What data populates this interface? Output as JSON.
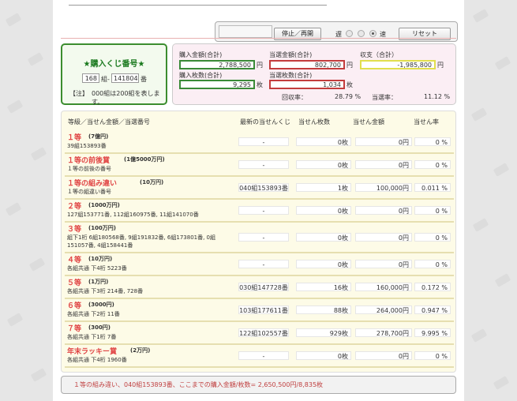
{
  "controls": {
    "stop_resume": "停止／再開",
    "slow_label": "遅",
    "fast_label": "速",
    "reset": "リセット",
    "speed_selected": "fast"
  },
  "ticket": {
    "title": "★購入くじ番号★",
    "group_value": "168",
    "group_suffix": "組-",
    "number_value": "141804",
    "number_suffix": "番",
    "note_label": "【注】",
    "note_text": "000組は200組を表します。"
  },
  "summary": {
    "purchase_amount_label": "購入金額(合計)",
    "purchase_amount": "2,788,500",
    "yen": "円",
    "purchase_count_label": "購入枚数(合計)",
    "purchase_count": "9,295",
    "mai": "枚",
    "win_amount_label": "当選金額(合計)",
    "win_amount": "802,700",
    "win_count_label": "当選枚数(合計)",
    "win_count": "1,034",
    "balance_label": "収支（合計）",
    "balance": "-1,985,800",
    "return_rate_label": "回収率：",
    "return_rate": "28.79 %",
    "win_rate_label": "当選率：",
    "win_rate": "11.12 %"
  },
  "table": {
    "headers": {
      "prize": "等級／当せん金額／当選番号",
      "latest": "最新の当せんくじ",
      "count": "当せん枚数",
      "amount": "当せん金額",
      "rate": "当せん率"
    },
    "rows": [
      {
        "name": "１等",
        "amount": "(7億円)",
        "sub1": "39組153893番",
        "sub2": "",
        "latest": "-",
        "count": "0枚",
        "money": "0円",
        "rate": "0 %"
      },
      {
        "name": "１等の前後賞",
        "amount": "(1億5000万円)",
        "sub1": "１等の前後の番号",
        "sub2": "",
        "latest": "-",
        "count": "0枚",
        "money": "0円",
        "rate": "0 %"
      },
      {
        "name": "１等の組み違い",
        "amount": "(10万円)",
        "sub1": "１等の組違い番号",
        "sub2": "",
        "latest": "040組153893番",
        "count": "1枚",
        "money": "100,000円",
        "rate": "0.011 %"
      },
      {
        "name": "２等",
        "amount": "(1000万円)",
        "sub1": "127組153771番, 112組160975番, 11組141070番",
        "sub2": "",
        "latest": "-",
        "count": "0枚",
        "money": "0円",
        "rate": "0 %"
      },
      {
        "name": "３等",
        "amount": "(100万円)",
        "sub1": "組下1桁 6組180568番, 9組191832番, 6組173801番, 0組",
        "sub2": "151057番, 4組158441番",
        "latest": "-",
        "count": "0枚",
        "money": "0円",
        "rate": "0 %"
      },
      {
        "name": "４等",
        "amount": "(10万円)",
        "sub1": "各組共通 下4桁 5223番",
        "sub2": "",
        "latest": "-",
        "count": "0枚",
        "money": "0円",
        "rate": "0 %"
      },
      {
        "name": "５等",
        "amount": "(1万円)",
        "sub1": "各組共通 下3桁 214番, 728番",
        "sub2": "",
        "latest": "030組147728番",
        "count": "16枚",
        "money": "160,000円",
        "rate": "0.172 %"
      },
      {
        "name": "６等",
        "amount": "(3000円)",
        "sub1": "各組共通 下2桁 11番",
        "sub2": "",
        "latest": "103組177611番",
        "count": "88枚",
        "money": "264,000円",
        "rate": "0.947 %"
      },
      {
        "name": "７等",
        "amount": "(300円)",
        "sub1": "各組共通 下1桁 7番",
        "sub2": "",
        "latest": "122組102557番",
        "count": "929枚",
        "money": "278,700円",
        "rate": "9.995 %"
      },
      {
        "name": "年末ラッキー賞",
        "amount": "(2万円)",
        "sub1": "各組共通 下4桁 1960番",
        "sub2": "",
        "latest": "-",
        "count": "0枚",
        "money": "0円",
        "rate": "0 %"
      }
    ]
  },
  "footer": {
    "message": "１等の組み違い、040組153893番、ここまでの購入金額/枚数= 2,650,500円/8,835枚"
  }
}
